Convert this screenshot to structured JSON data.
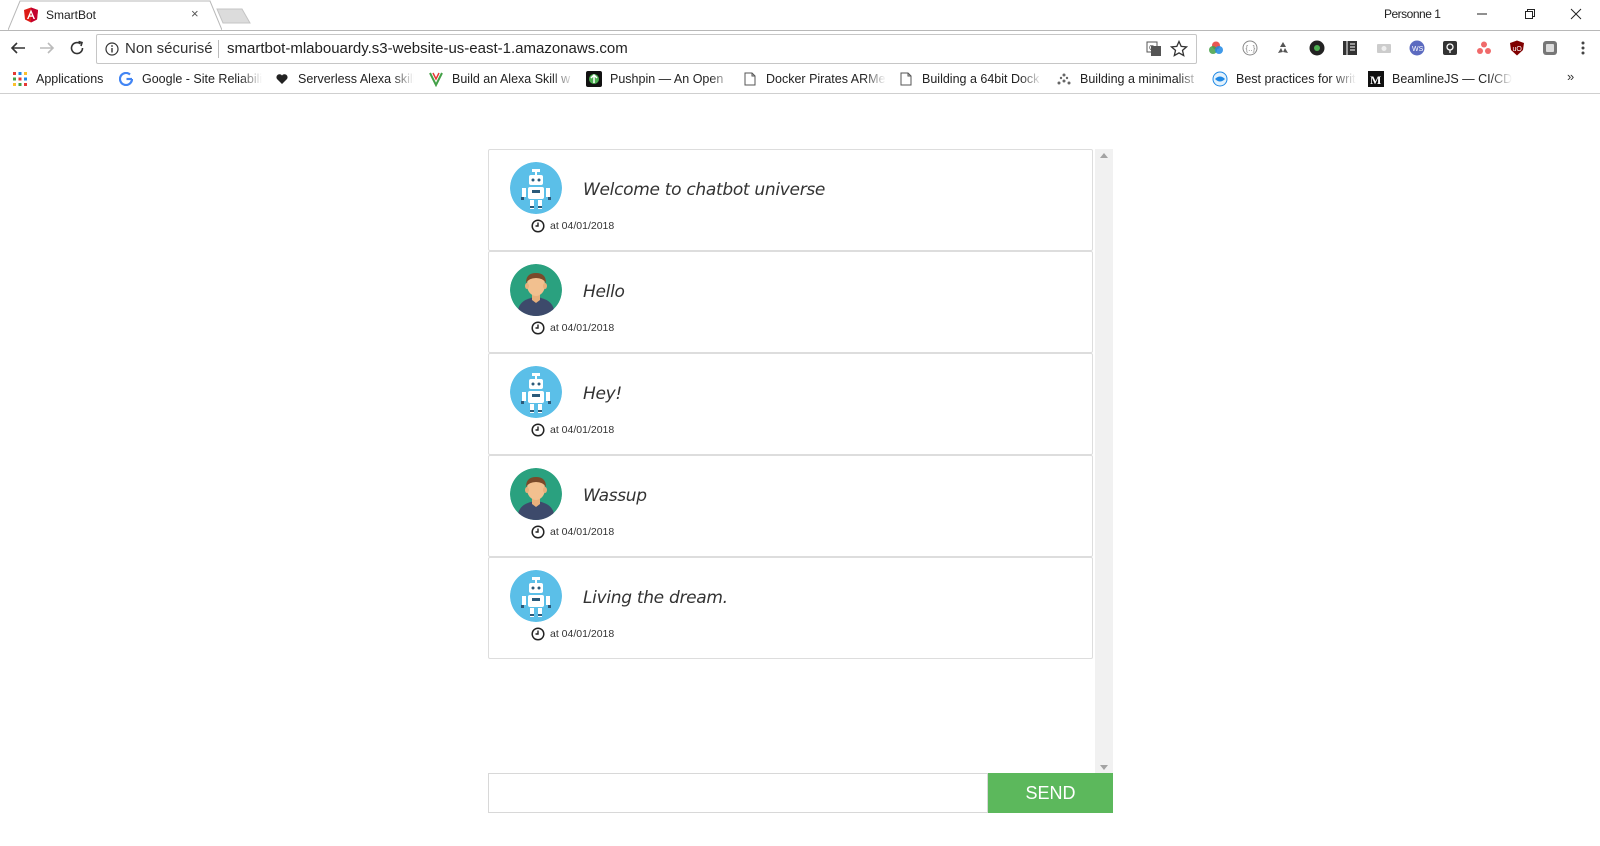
{
  "browser": {
    "tab": {
      "title": "SmartBot",
      "icon": "angular-icon",
      "close_label": "×"
    },
    "profile": "Personne 1",
    "window_controls": {
      "minimize": "minimize-icon",
      "restore": "restore-icon",
      "close": "close-icon"
    },
    "omnibox": {
      "security_label": "Non sécurisé",
      "url": "smartbot-mlabouardy.s3-website-us-east-1.amazonaws.com"
    },
    "bookmarks": [
      {
        "label": "Applications",
        "icon": "apps-grid-icon"
      },
      {
        "label": "Google - Site Reliabili",
        "icon": "google-icon"
      },
      {
        "label": "Serverless Alexa skill",
        "icon": "heart-icon"
      },
      {
        "label": "Build an Alexa Skill w",
        "icon": "alexa-icon"
      },
      {
        "label": "Pushpin — An Open",
        "icon": "pushpin-icon"
      },
      {
        "label": "Docker Pirates ARMe",
        "icon": "page-icon"
      },
      {
        "label": "Building a 64bit Dock",
        "icon": "page-icon"
      },
      {
        "label": "Building a minimalist",
        "icon": "dots-icon"
      },
      {
        "label": "Best practices for writ",
        "icon": "globe-icon"
      },
      {
        "label": "BeamlineJS — CI/CD",
        "icon": "medium-icon"
      }
    ],
    "bookmarks_more": "»",
    "accent_red": "#dd1b16"
  },
  "chat": {
    "messages": [
      {
        "sender": "bot",
        "text": "Welcome to chatbot universe",
        "time": "at 04/01/2018"
      },
      {
        "sender": "user",
        "text": "Hello",
        "time": "at 04/01/2018"
      },
      {
        "sender": "bot",
        "text": "Hey!",
        "time": "at 04/01/2018"
      },
      {
        "sender": "user",
        "text": "Wassup",
        "time": "at 04/01/2018"
      },
      {
        "sender": "bot",
        "text": "Living the dream.",
        "time": "at 04/01/2018"
      }
    ],
    "input_value": "",
    "send_label": "SEND",
    "colors": {
      "send": "#5cb85c",
      "bot_avatar": "#5bbfe8",
      "user_avatar": "#2aa17f"
    }
  }
}
